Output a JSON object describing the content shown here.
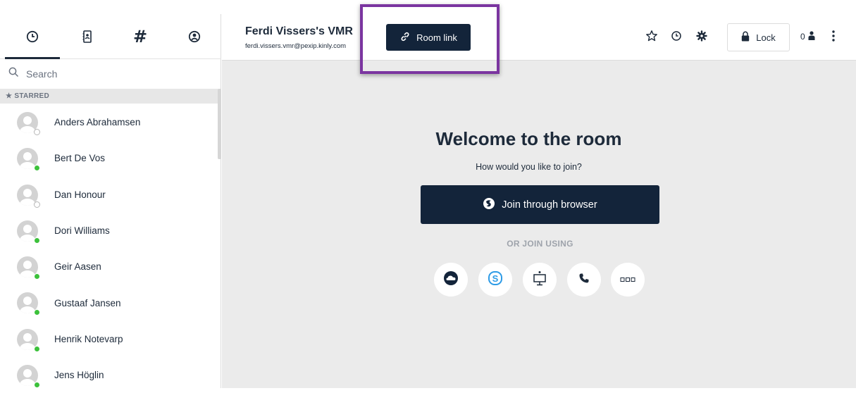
{
  "sidebar": {
    "tabs": [
      {
        "icon": "recent-clock-icon"
      },
      {
        "icon": "address-book-icon"
      },
      {
        "icon": "hash-icon",
        "glyph": "#"
      },
      {
        "icon": "user-circle-icon"
      }
    ],
    "search": {
      "placeholder": "Search"
    },
    "section_label": "★ STARRED",
    "contacts": [
      {
        "name": "Anders Abrahamsen",
        "status": "offline"
      },
      {
        "name": "Bert De Vos",
        "status": "online"
      },
      {
        "name": "Dan Honour",
        "status": "offline"
      },
      {
        "name": "Dori Williams",
        "status": "online"
      },
      {
        "name": "Geir Aasen",
        "status": "online"
      },
      {
        "name": "Gustaaf Jansen",
        "status": "online"
      },
      {
        "name": "Henrik Notevarp",
        "status": "online"
      },
      {
        "name": "Jens Höglin",
        "status": "online"
      }
    ]
  },
  "header": {
    "room_title": "Ferdi Vissers's VMR",
    "room_email": "ferdi.vissers.vmr@pexip.kinly.com",
    "room_link_label": "Room link",
    "lock_label": "Lock",
    "participant_count": "0",
    "icons": [
      "star-icon",
      "history-icon",
      "settings-gear-icon",
      "lock-icon",
      "person-icon",
      "more-vertical-icon"
    ]
  },
  "main": {
    "welcome_title": "Welcome to the room",
    "subtitle": "How would you like to join?",
    "join_browser_label": "Join through browser",
    "or_join_label": "OR JOIN USING",
    "join_options": [
      "cloud-icon",
      "skype-icon",
      "room-system-icon",
      "phone-icon",
      "more-options-icon"
    ]
  },
  "colors": {
    "primary": "#13243a",
    "highlight": "#7b35a0",
    "online": "#3cc13b",
    "background": "#ebebeb"
  }
}
